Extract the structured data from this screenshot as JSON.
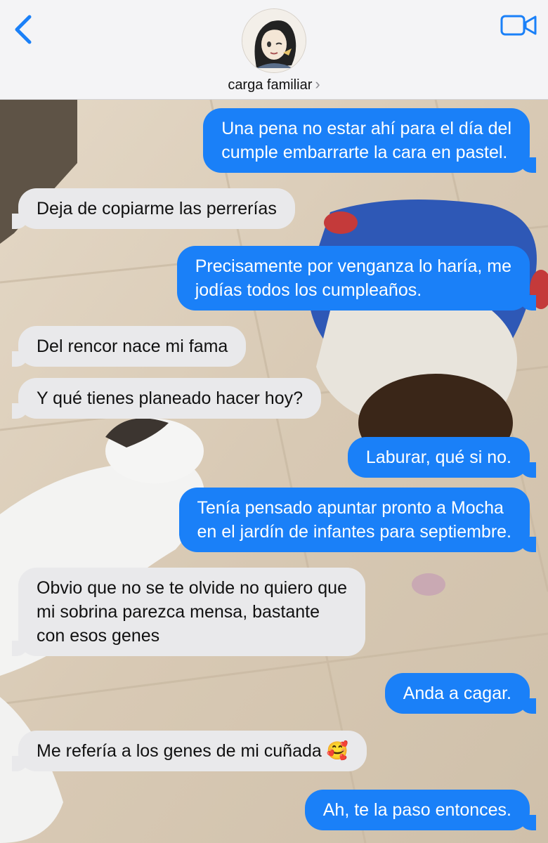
{
  "header": {
    "contact_name": "carga familiar",
    "chevron": "›",
    "back_icon": "chevron-left-icon",
    "video_icon": "video-camera-icon",
    "accent_color": "#1a80f8"
  },
  "messages": [
    {
      "direction": "outgoing",
      "text": "Una pena no estar ahí para el día del\ncumple embarrarte la cara en pastel."
    },
    {
      "direction": "incoming",
      "text": "Deja de copiarme las perrerías"
    },
    {
      "direction": "outgoing",
      "text": "Precisamente por venganza lo haría, me\njodías todos los cumpleaños."
    },
    {
      "direction": "incoming",
      "text": "Del rencor nace mi fama"
    },
    {
      "direction": "incoming",
      "text": "Y qué tienes planeado hacer hoy?"
    },
    {
      "direction": "outgoing",
      "text": "Laburar, qué si no."
    },
    {
      "direction": "outgoing",
      "text": "Tenía pensado apuntar pronto a Mocha\nen el jardín de infantes para septiembre."
    },
    {
      "direction": "incoming",
      "text": "Obvio que no se te olvide no quiero que\nmi sobrina parezca mensa, bastante\ncon esos genes"
    },
    {
      "direction": "outgoing",
      "text": "Anda a cagar."
    },
    {
      "direction": "incoming",
      "text": "Me refería a los genes de mi cuñada 🥰"
    },
    {
      "direction": "outgoing",
      "text": "Ah, te la paso entonces."
    }
  ]
}
